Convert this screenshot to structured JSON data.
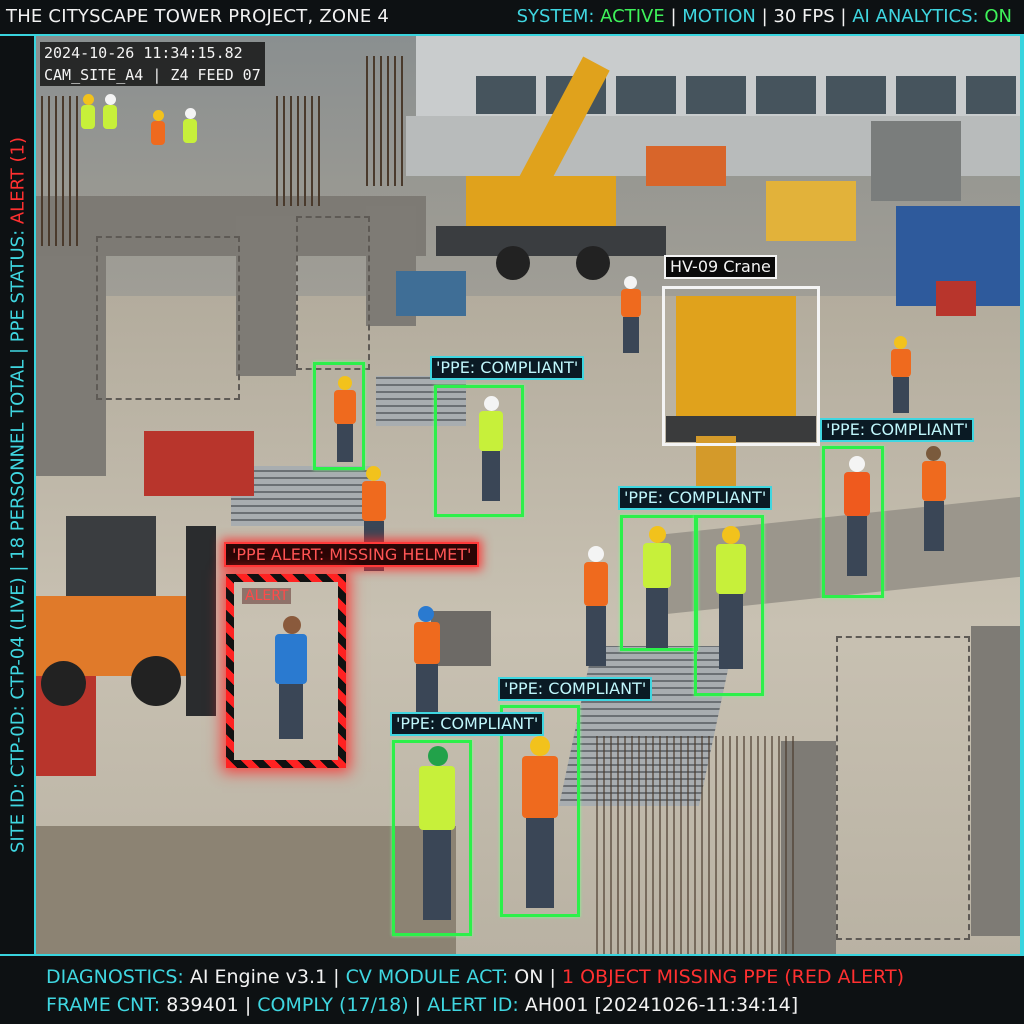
{
  "header": {
    "project_title": "THE CITYSCAPE TOWER PROJECT, ZONE 4",
    "status": {
      "system_label": "SYSTEM:",
      "system_value": "ACTIVE",
      "sep1": " | ",
      "motion": "MOTION",
      "sep2": " | ",
      "fps": "30 FPS",
      "sep3": " | ",
      "ai_label": "AI ANALYTICS:",
      "ai_value": "ON"
    }
  },
  "sidebar": {
    "site_id": "SITE ID: CTP-0D: CTP-04 (LIVE)",
    "sep1": "  |  ",
    "personnel": "18 PERSONNEL TOTAL",
    "sep2": "  |  ",
    "ppe_status_label": "PPE STATUS: ",
    "ppe_status_value": "ALERT (1)"
  },
  "feed": {
    "timestamp": "2024-10-26 11:34:15.82",
    "camera": "CAM_SITE_A4 | Z4 FEED 07"
  },
  "detections": {
    "equipment_label": "HV-09 Crane",
    "compliant_label": "'PPE: COMPLIANT'",
    "alert_label": "'PPE ALERT: MISSING HELMET'",
    "alert_tag": "ALERT"
  },
  "footer": {
    "diag_label": "DIAGNOSTICS:",
    "diag_value": " AI Engine v3.1",
    "sep1": "  |  ",
    "cv_label": "CV MODULE ACT:",
    "cv_value": " ON",
    "sep2": "  |  ",
    "alert_text": "1 OBJECT MISSING PPE (RED ALERT)",
    "frame_label": "FRAME CNT:",
    "frame_value": " 839401",
    "sep3": "  |  ",
    "comply": "COMPLY (17/18)",
    "sep4": "  |  ",
    "alert_id_label": "ALERT ID:",
    "alert_id_value": " AH001 [20241026-11:34:14]"
  },
  "colors": {
    "accent": "#39d4de",
    "compliant_green": "#2cf04a",
    "alert_red": "#ff3030"
  }
}
